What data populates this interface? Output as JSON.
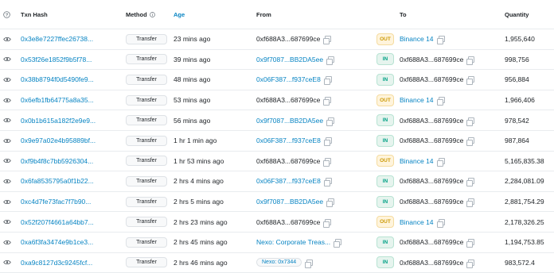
{
  "headers": {
    "help_icon": "?",
    "txn_hash": "Txn Hash",
    "method": "Method",
    "age": "Age",
    "from": "From",
    "to": "To",
    "quantity": "Quantity"
  },
  "colors": {
    "link": "#0784c3",
    "in_badge": "#00a186",
    "out_badge": "#cc9a06"
  },
  "rows": [
    {
      "hash": "0x3e8e7227ffec26738...",
      "method": "Transfer",
      "age": "23 mins ago",
      "from": "0xf688A3...687699ce",
      "from_link": false,
      "dir": "OUT",
      "to": "Binance 14",
      "to_link": true,
      "qty": "1,955,640"
    },
    {
      "hash": "0x53f26e1852f9b5f78...",
      "method": "Transfer",
      "age": "39 mins ago",
      "from": "0x9f7087...BB2DA5ee",
      "from_link": true,
      "dir": "IN",
      "to": "0xf688A3...687699ce",
      "to_link": false,
      "qty": "998,756"
    },
    {
      "hash": "0x38b8794f0d5490fe9...",
      "method": "Transfer",
      "age": "48 mins ago",
      "from": "0x06F387...f937ceE8",
      "from_link": true,
      "dir": "IN",
      "to": "0xf688A3...687699ce",
      "to_link": false,
      "qty": "956,884"
    },
    {
      "hash": "0x6efb1fb64775a8a35...",
      "method": "Transfer",
      "age": "53 mins ago",
      "from": "0xf688A3...687699ce",
      "from_link": false,
      "dir": "OUT",
      "to": "Binance 14",
      "to_link": true,
      "qty": "1,966,406"
    },
    {
      "hash": "0x0b1b615a182f2e9e9...",
      "method": "Transfer",
      "age": "56 mins ago",
      "from": "0x9f7087...BB2DA5ee",
      "from_link": true,
      "dir": "IN",
      "to": "0xf688A3...687699ce",
      "to_link": false,
      "qty": "978,542"
    },
    {
      "hash": "0x9e97a02e4b95889bf...",
      "method": "Transfer",
      "age": "1 hr 1 min ago",
      "from": "0x06F387...f937ceE8",
      "from_link": true,
      "dir": "IN",
      "to": "0xf688A3...687699ce",
      "to_link": false,
      "qty": "987,864"
    },
    {
      "hash": "0xf9b4f8c7bb5926304...",
      "method": "Transfer",
      "age": "1 hr 53 mins ago",
      "from": "0xf688A3...687699ce",
      "from_link": false,
      "dir": "OUT",
      "to": "Binance 14",
      "to_link": true,
      "qty": "5,165,835.38"
    },
    {
      "hash": "0x6fa8535795a0f1b22...",
      "method": "Transfer",
      "age": "2 hrs 4 mins ago",
      "from": "0x06F387...f937ceE8",
      "from_link": true,
      "dir": "IN",
      "to": "0xf688A3...687699ce",
      "to_link": false,
      "qty": "2,284,081.09"
    },
    {
      "hash": "0xc4d7fe73fac7f7b90...",
      "method": "Transfer",
      "age": "2 hrs 5 mins ago",
      "from": "0x9f7087...BB2DA5ee",
      "from_link": true,
      "dir": "IN",
      "to": "0xf688A3...687699ce",
      "to_link": false,
      "qty": "2,881,754.29"
    },
    {
      "hash": "0x52f207f4661a64bb7...",
      "method": "Transfer",
      "age": "2 hrs 23 mins ago",
      "from": "0xf688A3...687699ce",
      "from_link": false,
      "dir": "OUT",
      "to": "Binance 14",
      "to_link": true,
      "qty": "2,178,326.25"
    },
    {
      "hash": "0xa6f3fa3474e9b1ce3...",
      "method": "Transfer",
      "age": "2 hrs 45 mins ago",
      "from": "Nexo: Corporate Treas...",
      "from_link": true,
      "dir": "IN",
      "to": "0xf688A3...687699ce",
      "to_link": false,
      "qty": "1,194,753.85"
    },
    {
      "hash": "0xa9c8127d3c9245fcf...",
      "method": "Transfer",
      "age": "2 hrs 46 mins ago",
      "from": "Nexo: 0x7344",
      "from_link": true,
      "from_tag": true,
      "dir": "IN",
      "to": "0xf688A3...687699ce",
      "to_link": false,
      "qty": "983,572.4"
    }
  ]
}
